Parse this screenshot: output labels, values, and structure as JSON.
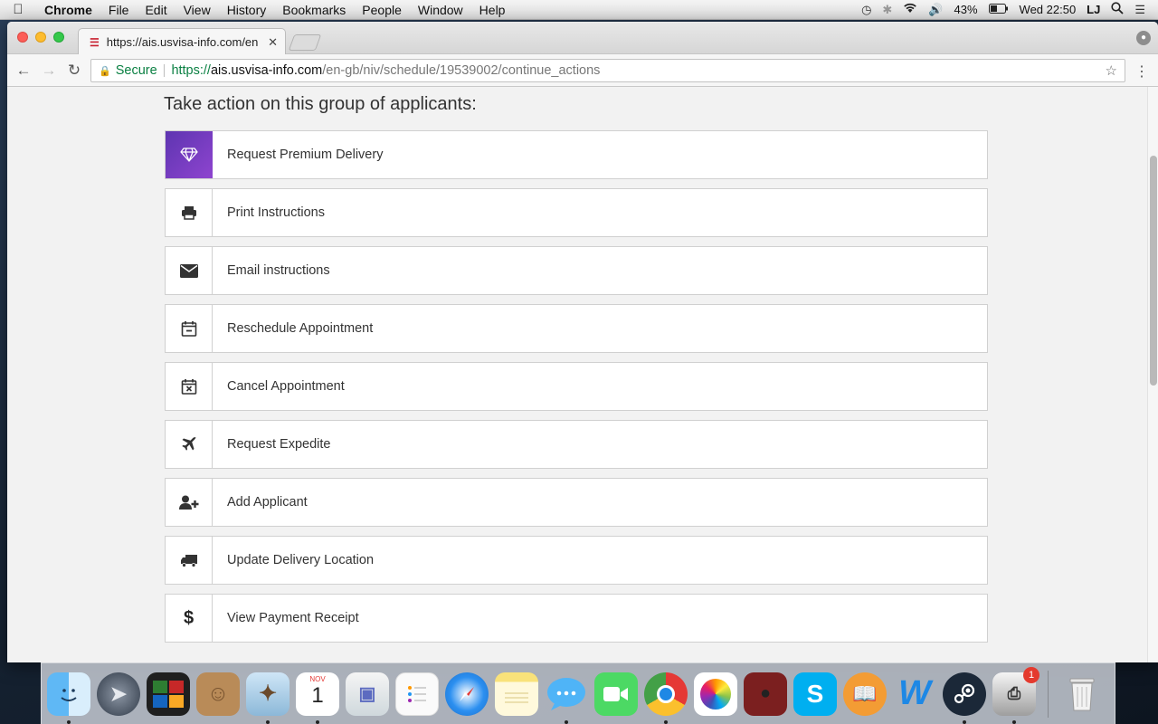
{
  "menubar": {
    "apple": "",
    "items": [
      "Chrome",
      "File",
      "Edit",
      "View",
      "History",
      "Bookmarks",
      "People",
      "Window",
      "Help"
    ],
    "battery": "43%",
    "clock": "Wed 22:50",
    "user": "LJ"
  },
  "browser": {
    "tab_title": "https://ais.usvisa-info.com/en",
    "url_secure_label": "Secure",
    "url_scheme": "https://",
    "url_host": "ais.usvisa-info.com",
    "url_path": "/en-gb/niv/schedule/19539002/continue_actions"
  },
  "page": {
    "heading": "Take action on this group of applicants:",
    "actions": [
      {
        "label": "Request Premium Delivery",
        "icon": "diamond-icon"
      },
      {
        "label": "Print Instructions",
        "icon": "printer-icon"
      },
      {
        "label": "Email instructions",
        "icon": "envelope-icon"
      },
      {
        "label": "Reschedule Appointment",
        "icon": "calendar-minus-icon"
      },
      {
        "label": "Cancel Appointment",
        "icon": "calendar-x-icon"
      },
      {
        "label": "Request Expedite",
        "icon": "plane-icon"
      },
      {
        "label": "Add Applicant",
        "icon": "user-plus-icon"
      },
      {
        "label": "Update Delivery Location",
        "icon": "truck-icon"
      },
      {
        "label": "View Payment Receipt",
        "icon": "dollar-icon"
      }
    ]
  },
  "dock": {
    "calendar_month": "NOV",
    "calendar_day": "1",
    "printer_badge": "1",
    "apps": [
      "finder-icon",
      "launchpad-icon",
      "photo-booth-icon",
      "contacts-icon",
      "mail-icon",
      "calendar-icon",
      "preview-icon",
      "reminders-icon",
      "safari-icon",
      "notes-icon",
      "messages-icon",
      "facetime-icon",
      "chrome-icon",
      "photos-icon",
      "photo-booth-2-icon",
      "skype-icon",
      "ibooks-icon",
      "word-icon",
      "steam-icon",
      "printer-icon",
      "trash-icon"
    ]
  }
}
